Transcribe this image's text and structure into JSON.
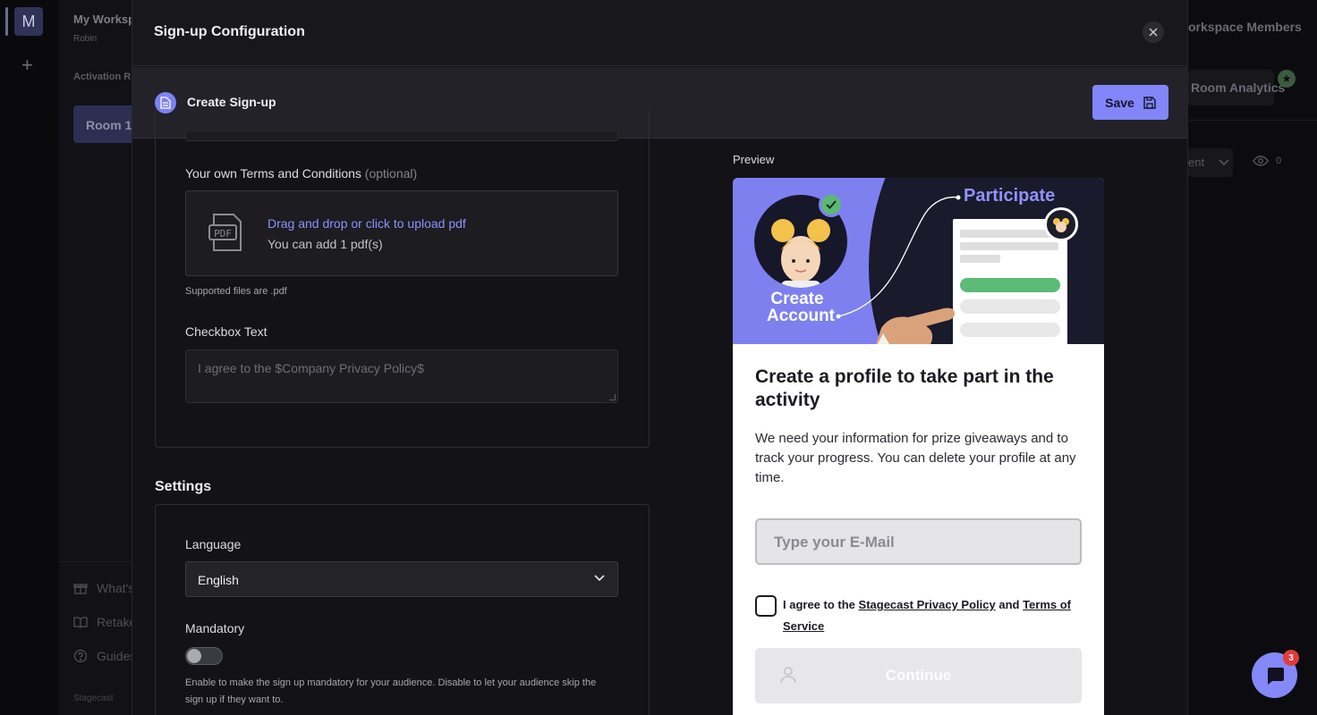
{
  "background": {
    "workspace_initial": "M",
    "add_label": "+",
    "workspace_name": "My Worksp",
    "workspace_user": "Robin",
    "section_label": "Activation R",
    "room_label": "Room 1",
    "nav_whats_new": "What's",
    "nav_retake": "Retake",
    "nav_guides": "Guides",
    "brand": "Stagecast",
    "members_label": "orkspace Members",
    "analytics_label": "Room Analytics",
    "select_partial": "ent",
    "views_count": "0"
  },
  "modal": {
    "title": "Sign-up Configuration",
    "toolbar_title": "Create Sign-up",
    "save_label": "Save"
  },
  "form": {
    "terms_label": "Your own Terms and Conditions",
    "terms_optional": "(optional)",
    "upload_link": "Drag and drop or click to upload pdf",
    "upload_sub": "You can add 1 pdf(s)",
    "supported_files": "Supported files are .pdf",
    "checkbox_text_label": "Checkbox Text",
    "checkbox_text_placeholder": "I agree to the $Company Privacy Policy$"
  },
  "settings": {
    "title": "Settings",
    "language_label": "Language",
    "language_value": "English",
    "mandatory_label": "Mandatory",
    "mandatory_on": false,
    "mandatory_hint": "Enable to make the sign up mandatory for your audience. Disable to let your audience skip the sign up if they want to."
  },
  "preview": {
    "label": "Preview",
    "hero_create_line1": "Create",
    "hero_create_line2": "Account",
    "hero_participate": "Participate",
    "title": "Create a profile to take part in the activity",
    "description": "We need your information for prize giveaways and to track your progress. You can delete your profile at any time.",
    "email_placeholder": "Type your E-Mail",
    "agree_prefix": "I agree to the ",
    "privacy_link": "Stagecast Privacy Policy",
    "agree_and": " and ",
    "terms_link": "Terms of Service",
    "continue_label": "Continue"
  },
  "chat": {
    "badge_count": "3"
  },
  "colors": {
    "accent": "#8286f8",
    "modal_bg": "#131317",
    "success": "#5cb874"
  }
}
